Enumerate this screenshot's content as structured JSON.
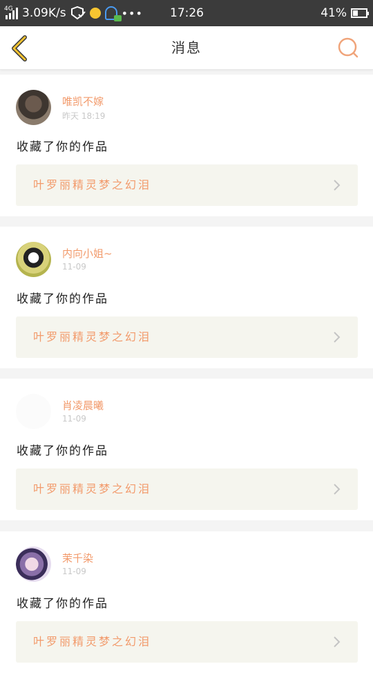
{
  "status_bar": {
    "network": "4G",
    "speed": "3.09K/s",
    "time": "17:26",
    "battery": "41%",
    "battery_level": 0.41
  },
  "header": {
    "title": "消息",
    "back_icon": "chevron-left-icon",
    "search_icon": "search-icon",
    "accent_color": "#f0a47a"
  },
  "messages": [
    {
      "username": "唯凯不嫁",
      "time": "昨天 18:19",
      "action": "收藏了你的作品",
      "work_title": "叶罗丽精灵梦之幻泪"
    },
    {
      "username": "内向小姐~",
      "time": "11-09",
      "action": "收藏了你的作品",
      "work_title": "叶罗丽精灵梦之幻泪"
    },
    {
      "username": "肖凌晨曦",
      "time": "11-09",
      "action": "收藏了你的作品",
      "work_title": "叶罗丽精灵梦之幻泪"
    },
    {
      "username": "茉千染",
      "time": "11-09",
      "action": "收藏了你的作品",
      "work_title": "叶罗丽精灵梦之幻泪"
    }
  ]
}
